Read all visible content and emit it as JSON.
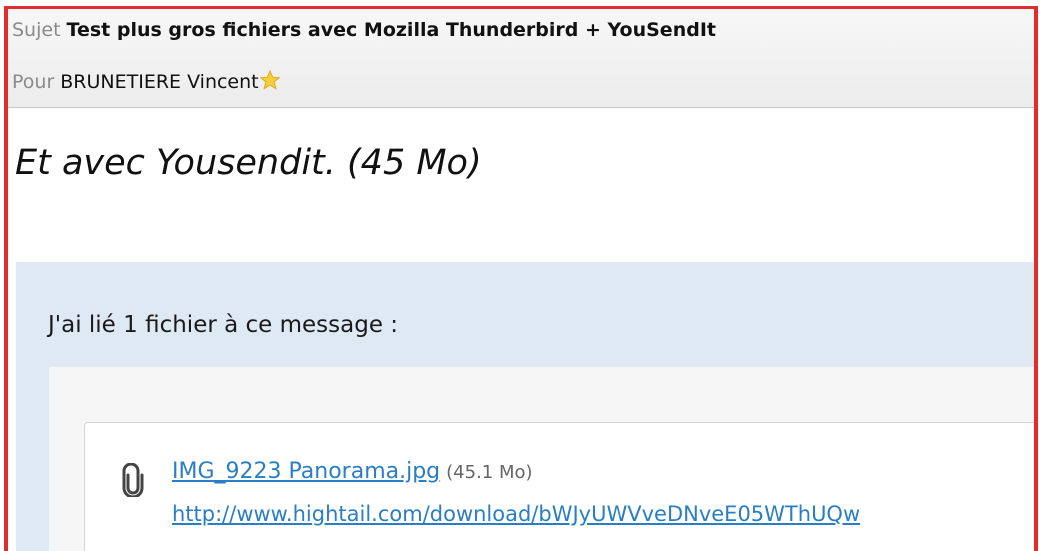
{
  "header": {
    "subject_label": "Sujet",
    "subject_value": "Test plus gros fichiers avec Mozilla Thunderbird + YouSendIt",
    "to_label": "Pour",
    "to_value": "BRUNETIERE Vincent"
  },
  "body": {
    "headline": "Et avec Yousendit. (45 Mo)"
  },
  "attachment_panel": {
    "intro": "J'ai lié 1 fichier à ce message :",
    "file_name": "IMG_9223 Panorama.jpg",
    "file_size": "(45.1 Mo)",
    "url": "http://www.hightail.com/download/bWJyUWVveDNveE05WThUQw"
  },
  "icons": [
    "star-icon",
    "paperclip-icon"
  ],
  "colors": {
    "frame": "#e22b2b",
    "link": "#2a7ec4",
    "panel": "#dfe9f4"
  }
}
